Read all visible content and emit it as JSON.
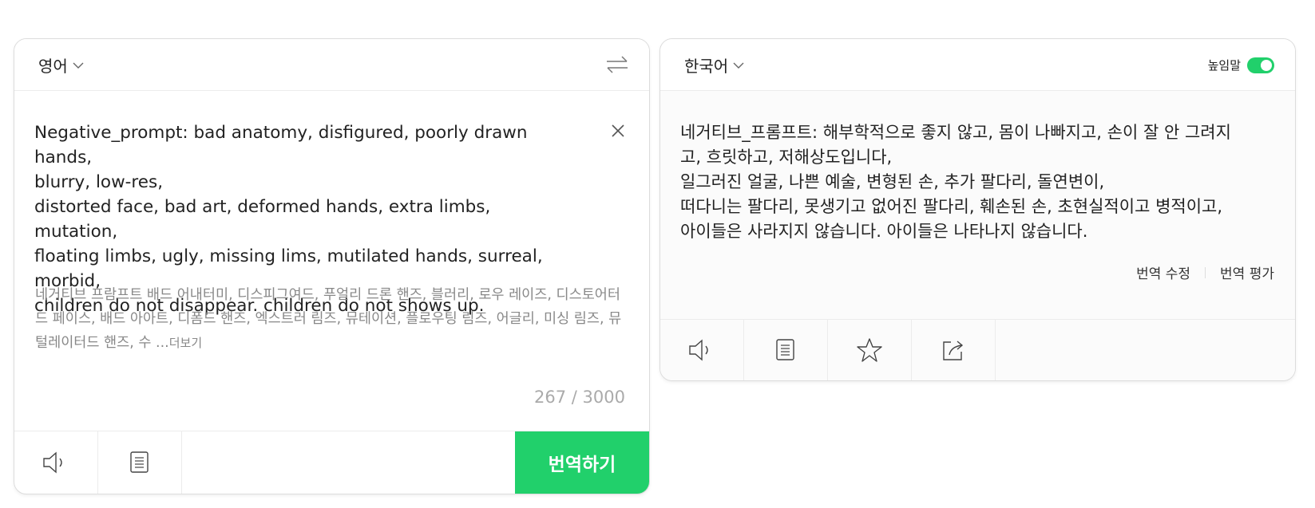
{
  "source": {
    "language": "영어",
    "text": "Negative_prompt: bad anatomy, disfigured, poorly drawn hands,\nblurry, low-res,\ndistorted face, bad art, deformed hands, extra limbs, mutation,\nfloating limbs, ugly, missing lims, mutilated hands, surreal,\nmorbid,\nchildren do not disappear. children do not shows up.",
    "pronunciation": "네거티브 프람프트 배드 어내터미, 디스피그여드, 푸얼리 드론 핸즈, 블러리, 로우 레이즈, 디스토어터드 페이스, 배드 아아트, 디폼드 핸즈, 엑스트러 림즈, 뮤테이션, 플로우팅 림즈, 어글리, 미싱 림즈, 뮤털레이터드 핸즈, 수 ...",
    "more_label": "더보기",
    "char_count": "267 / 3000",
    "translate_label": "번역하기"
  },
  "target": {
    "language": "한국어",
    "honorific_label": "높임말",
    "honorific_on": true,
    "text": "네거티브_프롬프트: 해부학적으로 좋지 않고, 몸이 나빠지고, 손이 잘 안 그려지\n고, 흐릿하고, 저해상도입니다,\n일그러진 얼굴, 나쁜 예술, 변형된 손, 추가 팔다리, 돌연변이,\n떠다니는 팔다리, 못생기고 없어진 팔다리, 훼손된 손, 초현실적이고 병적이고,\n아이들은 사라지지 않습니다. 아이들은 나타나지 않습니다.",
    "edit_label": "번역 수정",
    "rate_label": "번역 평가"
  },
  "colors": {
    "accent": "#21d06b",
    "border": "#dcdcdc"
  },
  "icons": [
    "chevron-down-icon",
    "swap-languages-icon",
    "close-icon",
    "speaker-icon",
    "copy-icon",
    "star-icon",
    "share-icon"
  ]
}
